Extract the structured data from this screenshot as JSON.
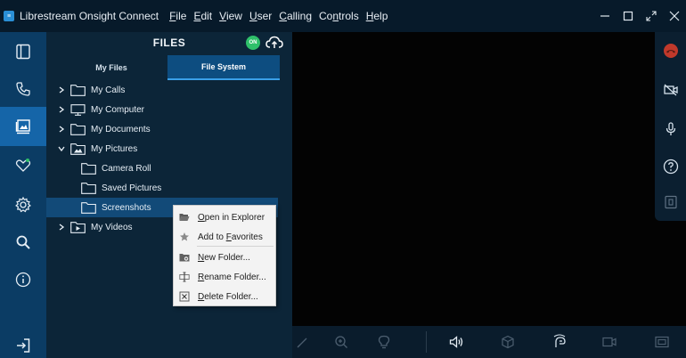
{
  "window": {
    "title": "Librestream Onsight Connect",
    "logo": "app-logo-icon"
  },
  "menu": [
    {
      "pre": "",
      "u": "F",
      "post": "ile"
    },
    {
      "pre": "",
      "u": "E",
      "post": "dit"
    },
    {
      "pre": "",
      "u": "V",
      "post": "iew"
    },
    {
      "pre": "",
      "u": "U",
      "post": "ser"
    },
    {
      "pre": "",
      "u": "C",
      "post": "alling"
    },
    {
      "pre": "Co",
      "u": "n",
      "post": "trols"
    },
    {
      "pre": "",
      "u": "H",
      "post": "elp"
    }
  ],
  "rail": [
    "panel-toggle-icon",
    "phone-icon",
    "files-icon",
    "favorites-icon",
    "settings-icon",
    "search-icon",
    "info-icon",
    "logout-icon"
  ],
  "files": {
    "title": "FILES",
    "status_badge": "ON",
    "tabs": [
      "My Files",
      "File System"
    ],
    "active_tab": 1,
    "tree": [
      {
        "label": "My Calls",
        "expanded": false,
        "level": 0,
        "icon": "folder-icon"
      },
      {
        "label": "My Computer",
        "expanded": false,
        "level": 0,
        "icon": "computer-icon"
      },
      {
        "label": "My Documents",
        "expanded": false,
        "level": 0,
        "icon": "folder-icon"
      },
      {
        "label": "My Pictures",
        "expanded": true,
        "level": 0,
        "icon": "pictures-folder-icon"
      },
      {
        "label": "Camera Roll",
        "level": 1,
        "icon": "folder-icon"
      },
      {
        "label": "Saved Pictures",
        "level": 1,
        "icon": "folder-icon"
      },
      {
        "label": "Screenshots",
        "level": 1,
        "icon": "folder-icon",
        "selected": true
      },
      {
        "label": "My Videos",
        "expanded": false,
        "level": 0,
        "icon": "videos-folder-icon"
      }
    ]
  },
  "context_menu": [
    {
      "pre": "",
      "u": "O",
      "post": "pen in Explorer",
      "icon": "open-folder-icon"
    },
    {
      "pre": "Add to ",
      "u": "F",
      "post": "avorites",
      "icon": "star-icon"
    },
    {
      "pre": "",
      "u": "N",
      "post": "ew Folder...",
      "icon": "new-folder-icon"
    },
    {
      "pre": "",
      "u": "R",
      "post": "ename Folder...",
      "icon": "rename-icon"
    },
    {
      "pre": "",
      "u": "D",
      "post": "elete Folder...",
      "icon": "delete-icon"
    }
  ],
  "right_tools": [
    "end-call-icon",
    "camera-off-icon",
    "microphone-icon",
    "help-icon",
    "share-icon"
  ],
  "bottom_tools": [
    "pen-icon",
    "zoom-in-icon",
    "light-icon",
    "speaker-icon",
    "3d-box-icon",
    "gesture-icon",
    "video-icon",
    "screen-icon"
  ],
  "colors": {
    "rail_bg": "#0b3c64",
    "rail_active": "#1565a8",
    "panel_bg": "#0c2538",
    "tab_active": "#0d4d80",
    "selected_row": "#124a78",
    "status_on": "#2fc06a",
    "end_call": "#c0392b"
  }
}
